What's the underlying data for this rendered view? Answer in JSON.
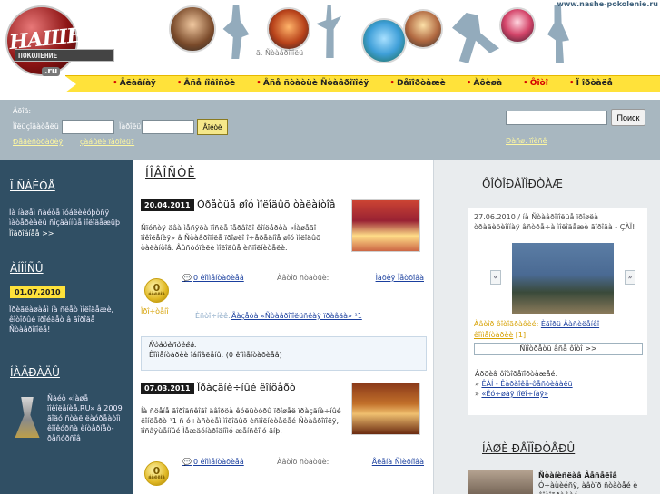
{
  "header": {
    "logo_top": "НАШЕ",
    "logo_mid": "ПОКОЛЕНИЕ",
    "logo_badge": ".ru",
    "site_url": "www.nashe-pokolenie.ru",
    "caption": "ã. Ñòàâðîïîëü"
  },
  "nav": {
    "items": [
      {
        "label": "Ãëàâíàÿ",
        "active": false
      },
      {
        "label": "Âñå íîâîñòè",
        "active": false
      },
      {
        "label": "Âñå ñòàòüè Ñòàâðîïîëÿ",
        "active": false
      },
      {
        "label": "Ðåïîðòàæè",
        "active": false
      },
      {
        "label": "Àôèøà",
        "active": false
      },
      {
        "label": "Ôîòî",
        "active": true
      },
      {
        "label": "Ï îðòàëå",
        "active": false
      }
    ]
  },
  "auth": {
    "title": "Âõîä:",
    "user_label": "Ïîëüçîâàòåëü",
    "pass_label": "Ïàðîëü",
    "login_btn": "Âîéòè",
    "register_link": "Ðåãèñòðàöèÿ",
    "forgot_link": "çàáûëè ïàðîëü?",
    "search_btn": "Поиск",
    "adv_search_link": "Ðàñø. ïîèñê"
  },
  "left": {
    "about_title": "Î ÑÀÉÒÅ",
    "about_text": "Íà íàøåì ñàéòå ïóáëèêóþòñÿ ìàòåðèàëû ñîçäàííûå ìîëîäåæüþ",
    "about_more": "Ïîäðîáíåå >>",
    "announce_title": "ÀÍÎÍÑÛ",
    "announce_date": "01.07.2010",
    "announce_text": "Ïðèãëàøàåì íà ñëåò ìîëîäåæè, êîòîðûé ïðîéäåò â ãîðîäå Ñòàâðîïîëå!",
    "awards_title": "ÍÀÃÐÀÄÛ",
    "awards_text": "Ñàéò «Íàøå ïîêîëåíèå.RU» â 2009 ãîäó ñòàë ëàóðåàòîì êîíêóðñà èíòåðíåò-ðåñóðñîâ"
  },
  "center": {
    "heading": "ÍÎÂÎÑÒÈ",
    "news": [
      {
        "date": "20.04.2011",
        "title": "Òðåòüå øîó ìîëîäûõ òàëàíòîâ",
        "body": "Ñïóñòÿ äâà ìåñÿöà ïîñëå ïåðâîãî êîíöåðòà «Íàøåãî ïîêîëåíèÿ» â Ñòàâðîïîëå ïðîøëî î÷åðåäíîå øîó ìîëîäûõ òàëàíòîâ. Âûñòóïèëè ìîëîäûå èñïîëíèòåëè.",
        "medal_num": "0",
        "medal_txt": "áàëëîâ",
        "reads": "Ïðî÷òåíî",
        "comments": "0 êîììåíòàðèåâ",
        "author_label": "Àâòîð ñòàòüè:",
        "author": "Ìàðèÿ Ïåòðîâà",
        "source_label": "Èñòî÷íèê:",
        "source": "Ãàçåòà «Ñòàâðîïîëüñêàÿ ïðàâäà» ¹1"
      },
      {
        "date": "07.03.2011",
        "title": "Ïðàçäíè÷íûé êîíöåðò",
        "body": "Íà ñöåíå ãîðîäñêîãî äâîðöà êóëüòóðû ïðîøåë ïðàçäíè÷íûé êîíöåðò ¹1 ñ ó÷àñòèåì ìîëîäûõ èñïîëíèòåëåé Ñòàâðîïîëÿ, ïîñâÿùåííûé Ìåæäóíàðîäíîìó æåíñêîìó äíþ.",
        "medal_num": "0",
        "medal_txt": "áàëëîâ",
        "reads": "",
        "comments": "0 êîììåíòàðèåâ",
        "author_label": "Àâòîð ñòàòüè:",
        "author": "Åëåíà Ñìèðíîâà",
        "source_label": "",
        "source": ""
      }
    ],
    "stats_title": "Ñòàòèñòèêà:",
    "stats_text": "Êîììåíòàðèè îáíîâëåíû: (0 êîììåíòàðèåâ)"
  },
  "right": {
    "photo_title": "ÔÎÒÎÐÅÏÎÐÒÀÆ",
    "photo_meta": "27.06.2010 / íà Ñòàâðîïîëüå ïðîøëà òðàäèöèîííàÿ âñòðå÷à ìîëîäåæè ãîðîäà - ÇÀÏ!",
    "photo_author_label": "Àâòîð ôîòîãðàôèé:",
    "photo_author": "Èãîðü Âàñèëåíêî",
    "photo_comments": "êîììåíòàðèè",
    "photo_count": "[1]",
    "all_photos": "Ñìîòðåòü âñå ôîòî >>",
    "links_title": "Àðõèâ ôîòîðåïîðòàæåé:",
    "links": [
      "ÊÀÍ - Êàðàîêå-ôåñòèâàëü",
      "«Ëó÷øàÿ ìîëî÷íàÿ»"
    ],
    "title2": "ÍÀØÈ ÐÅÏÎÐÒÅÐÛ",
    "reporter_name": "Ñòàíèñëàâ Âåñåëîâ",
    "reporter_text": "Ó÷àùèéñÿ, àâòîð ñòàòåé è ôîòîãðàôèé"
  }
}
